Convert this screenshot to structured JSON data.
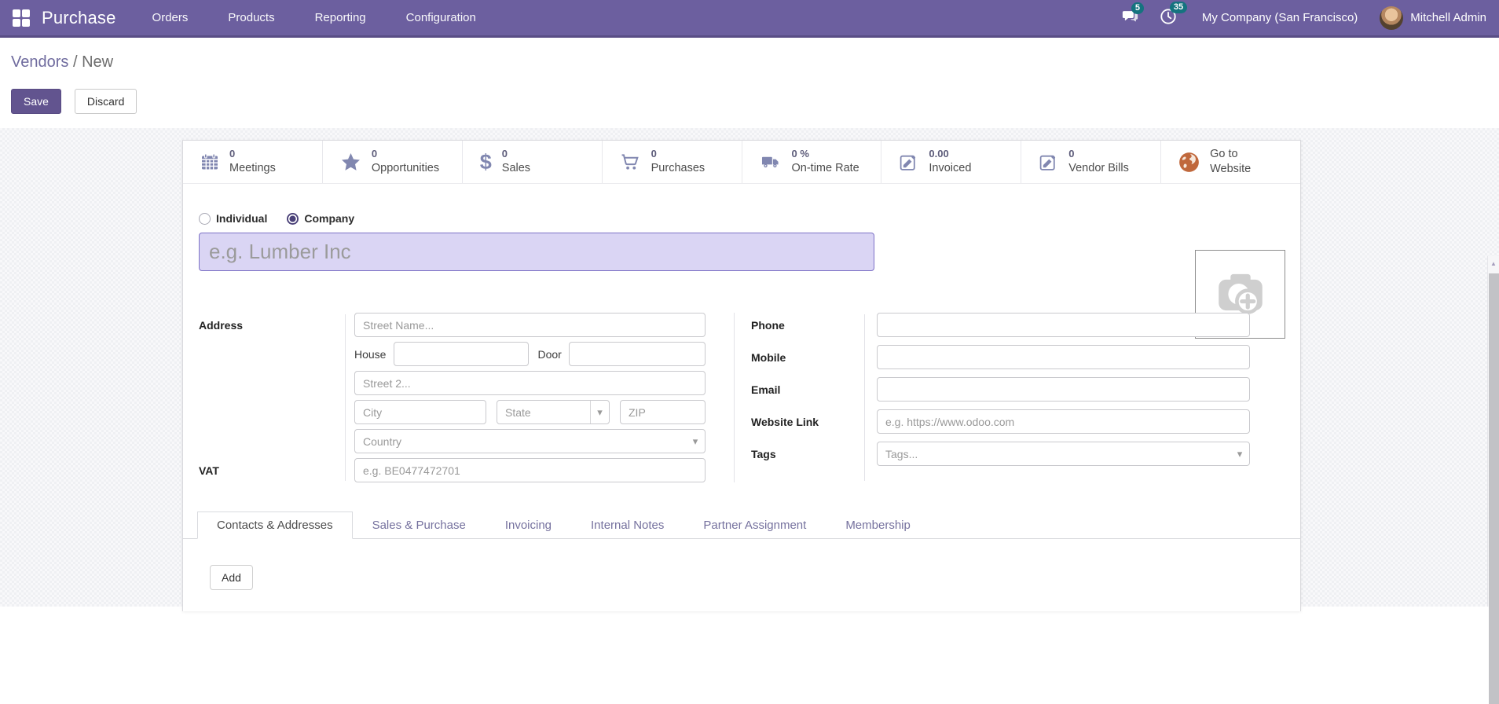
{
  "colors": {
    "navbar_bg": "#6c5f9f",
    "badge_teal": "#15737f",
    "primary_button": "#62548f",
    "name_input_bg": "#dad5f4",
    "name_input_border": "#7d72c6",
    "stat_icon": "#8187b0",
    "globe_orange": "#c0683c",
    "inactive_tab": "#75719e"
  },
  "navbar": {
    "app_name": "Purchase",
    "menus": [
      "Orders",
      "Products",
      "Reporting",
      "Configuration"
    ],
    "messages_badge": "5",
    "activities_badge": "35",
    "company_name": "My Company (San Francisco)",
    "user_name": "Mitchell Admin",
    "icons": [
      "apps-grid-icon",
      "chat-icon",
      "clock-icon",
      "avatar"
    ]
  },
  "breadcrumb": {
    "parent": "Vendors",
    "separator": "/",
    "current": "New"
  },
  "control_panel": {
    "save_label": "Save",
    "discard_label": "Discard"
  },
  "stat_buttons": [
    {
      "icon": "calendar-icon",
      "value": "0",
      "label": "Meetings"
    },
    {
      "icon": "star-icon",
      "value": "0",
      "label": "Opportunities"
    },
    {
      "icon": "dollar-icon",
      "value": "0",
      "label": "Sales"
    },
    {
      "icon": "cart-icon",
      "value": "0",
      "label": "Purchases"
    },
    {
      "icon": "truck-icon",
      "value": "0 %",
      "label": "On-time Rate"
    },
    {
      "icon": "edit-square-icon",
      "value": "0.00",
      "label": "Invoiced"
    },
    {
      "icon": "edit-square-icon",
      "value": "0",
      "label": "Vendor Bills"
    },
    {
      "icon": "globe-icon",
      "value": "Go to",
      "label": "Website"
    }
  ],
  "form": {
    "company_type": {
      "individual_label": "Individual",
      "company_label": "Company",
      "selected": "Company"
    },
    "name_placeholder": "e.g. Lumber Inc",
    "photo_icon": "camera-plus-icon",
    "address": {
      "label": "Address",
      "street_placeholder": "Street Name...",
      "house_label": "House",
      "door_label": "Door",
      "street2_placeholder": "Street 2...",
      "city_placeholder": "City",
      "state_placeholder": "State",
      "zip_placeholder": "ZIP",
      "country_placeholder": "Country"
    },
    "vat": {
      "label": "VAT",
      "placeholder": "e.g. BE0477472701"
    },
    "contact": {
      "phone_label": "Phone",
      "mobile_label": "Mobile",
      "email_label": "Email",
      "website_label": "Website Link",
      "website_placeholder": "e.g. https://www.odoo.com",
      "tags_label": "Tags",
      "tags_placeholder": "Tags..."
    }
  },
  "tabs": [
    {
      "label": "Contacts & Addresses",
      "active": true
    },
    {
      "label": "Sales & Purchase",
      "active": false
    },
    {
      "label": "Invoicing",
      "active": false
    },
    {
      "label": "Internal Notes",
      "active": false
    },
    {
      "label": "Partner Assignment",
      "active": false
    },
    {
      "label": "Membership",
      "active": false
    }
  ],
  "tab_content": {
    "add_label": "Add"
  }
}
